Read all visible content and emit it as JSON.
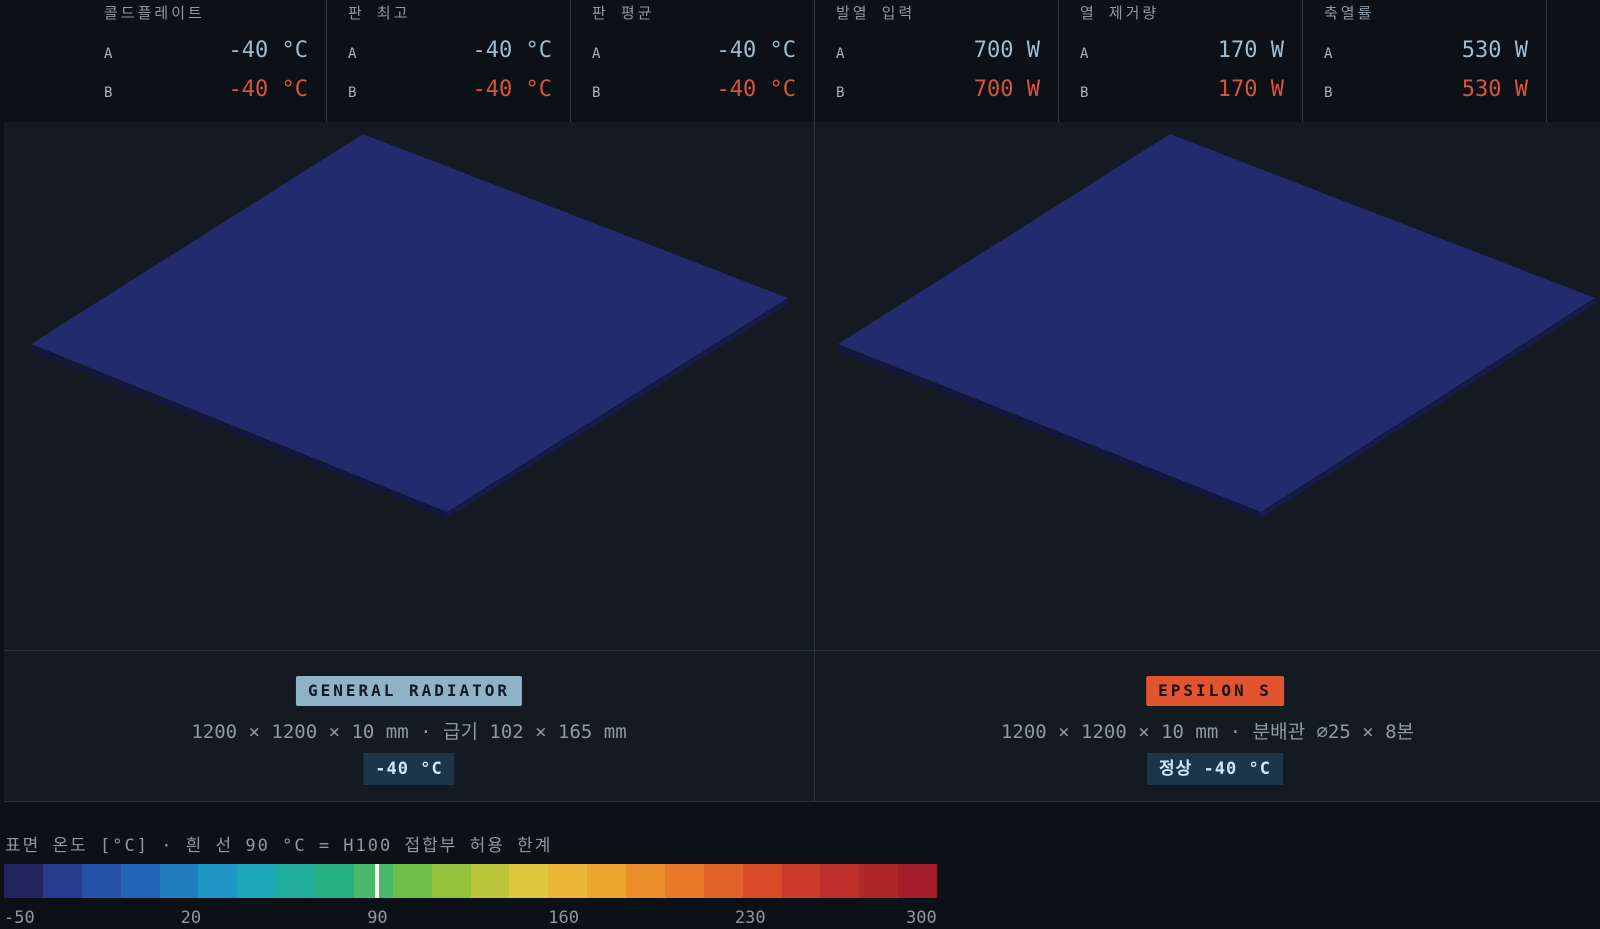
{
  "stats": [
    {
      "title": "콜드플레이트",
      "a_label": "A",
      "a_value": "-40 °C",
      "b_label": "B",
      "b_value": "-40 °C"
    },
    {
      "title": "판 최고",
      "a_label": "A",
      "a_value": "-40 °C",
      "b_label": "B",
      "b_value": "-40 °C"
    },
    {
      "title": "판 평균",
      "a_label": "A",
      "a_value": "-40 °C",
      "b_label": "B",
      "b_value": "-40 °C"
    },
    {
      "title": "발열 입력",
      "a_label": "A",
      "a_value": "700 W",
      "b_label": "B",
      "b_value": "700 W"
    },
    {
      "title": "열 제거량",
      "a_label": "A",
      "a_value": "170 W",
      "b_label": "B",
      "b_value": "170 W"
    },
    {
      "title": "축열률",
      "a_label": "A",
      "a_value": "530 W",
      "b_label": "B",
      "b_value": "530 W"
    }
  ],
  "panels": {
    "left": {
      "badge": "GENERAL RADIATOR",
      "dims": "1200 × 1200 × 10 mm · 급기 102 × 165 mm",
      "temp": "-40 °C",
      "plate_color": "#232a6e"
    },
    "right": {
      "badge": "EPSILON S",
      "dims": "1200 × 1200 × 10 mm · 분배관 ⌀25 × 8본",
      "temp": "정상 -40 °C",
      "plate_color": "#232a6e"
    }
  },
  "legend": {
    "title": "표면 온도 [°C] · 흰 선 90 °C = H100 접합부 허용 한계",
    "ticks": [
      "-50",
      "20",
      "90",
      "160",
      "230",
      "300"
    ],
    "min": -50,
    "max": 300,
    "limit": 90,
    "colors": [
      "#21245e",
      "#273c8c",
      "#2551a8",
      "#2264b5",
      "#1f7cbd",
      "#1e95c2",
      "#1ea8b7",
      "#21ad9b",
      "#29b082",
      "#4ab96b",
      "#6fc04a",
      "#95c43c",
      "#bcc63a",
      "#dcc73a",
      "#e9b636",
      "#eda530",
      "#ec8f2b",
      "#e97929",
      "#e26229",
      "#d94c29",
      "#cc3c2a",
      "#bd302a",
      "#b0272a",
      "#a51d2a"
    ]
  },
  "colors": {
    "accent_blue": "#8fb2c6",
    "accent_red": "#e0542f",
    "value_a": "#9fbcd0",
    "value_b": "#d8543a"
  }
}
